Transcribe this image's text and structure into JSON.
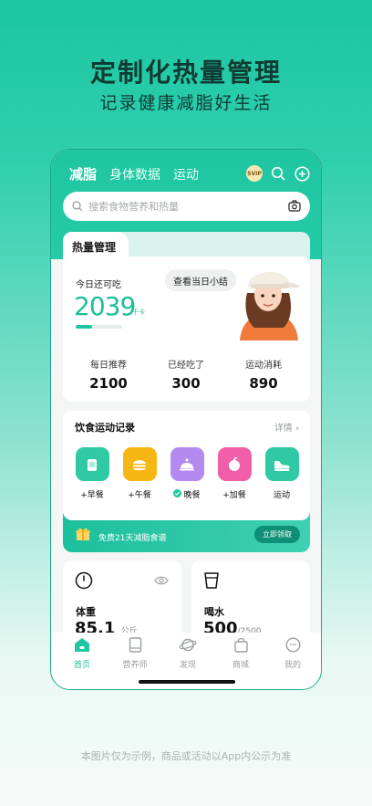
{
  "hero": {
    "title": "定制化热量管理",
    "subtitle": "记录健康减脂好生活"
  },
  "tabs": [
    "减脂",
    "身体数据",
    "运动"
  ],
  "svip": "SVIP",
  "search": {
    "placeholder": "搜索食物营养和热量"
  },
  "heat": {
    "tab_label": "热量管理",
    "remain_label": "今日还可吃",
    "remain_value": "2039",
    "remain_unit": "千卡",
    "progress": 0.35,
    "bubble": "查看当日小结",
    "stats": [
      {
        "label": "每日推荐",
        "value": "2100"
      },
      {
        "label": "已经吃了",
        "value": "300"
      },
      {
        "label": "运动消耗",
        "value": "890"
      }
    ]
  },
  "meal": {
    "title": "饮食运动记录",
    "more": "详情",
    "items": [
      {
        "label": "+早餐",
        "color": "#2fcaa5"
      },
      {
        "label": "+午餐",
        "color": "#f6b614"
      },
      {
        "label": "晚餐",
        "color": "#b48af0"
      },
      {
        "label": "+加餐",
        "color": "#f05fa8"
      },
      {
        "label": "运动",
        "color": "#2fcaa5"
      }
    ],
    "promo_text": "免费21天减脂食谱",
    "promo_button": "立即领取"
  },
  "cards": {
    "weight": {
      "label": "体重",
      "value": "85.1",
      "unit": "公斤"
    },
    "water": {
      "label": "喝水",
      "value": "500",
      "unit": "/2500"
    }
  },
  "nav": [
    {
      "label": "首页",
      "icon": "home-icon"
    },
    {
      "label": "营养师",
      "icon": "book-icon"
    },
    {
      "label": "发现",
      "icon": "planet-icon"
    },
    {
      "label": "商城",
      "icon": "bag-icon"
    },
    {
      "label": "我的",
      "icon": "profile-icon"
    }
  ],
  "footer_note": "本图片仅为示例，商品或活动以App内公示为准",
  "colors": {
    "brand": "#20c6a2",
    "dark_green": "#0f8f75"
  }
}
